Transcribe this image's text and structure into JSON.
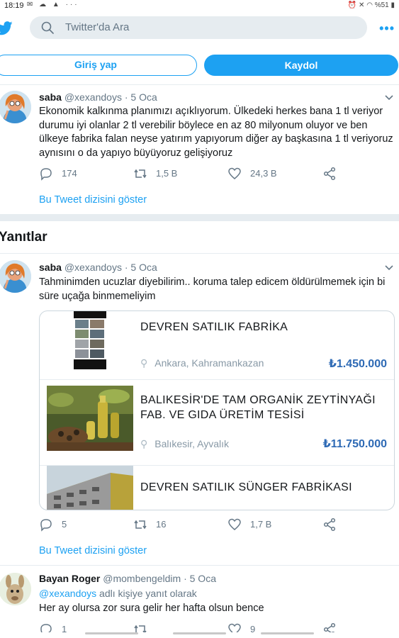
{
  "status_bar": {
    "time": "18:19",
    "left_icons": "✉ ☁ ▲ ···",
    "right_icons": "⏰ ✕ ◠ %51 ▮",
    "battery": "%51"
  },
  "header": {
    "search_placeholder": "Twitter'da Ara",
    "more_label": "•••",
    "login_label": "Giriş yap",
    "signup_label": "Kaydol"
  },
  "main_tweet": {
    "name": "saba",
    "handle": "@xexandoys",
    "dot": "·",
    "date": "5 Oca",
    "text": "Ekonomik kalkınma planımızı açıklıyorum. Ülkedeki herkes bana 1 tl veriyor durumu iyi olanlar 2 tl verebilir böylece en az 80 milyonum oluyor ve ben ülkeye fabrika falan neyse yatırım yapıyorum diğer ay başkasına 1 tl veriyoruz aynısını o da yapıyo büyüyoruz gelişiyoruz",
    "replies": "174",
    "retweets": "1,5 B",
    "likes": "24,3 B",
    "show_thread": "Bu Tweet dizisini göster"
  },
  "replies_section": {
    "title": "Yanıtlar"
  },
  "reply_tweet": {
    "name": "saba",
    "handle": "@xexandoys",
    "dot": "·",
    "date": "5 Oca",
    "text": "Tahminimden ucuzlar diyebilirim.. koruma talep edicem öldürülmemek için bi süre uçağa binmemeliyim",
    "listings": [
      {
        "title": "DEVREN SATILIK FABRİKA",
        "location": "Ankara, Kahramankazan",
        "price": "₺1.450.000"
      },
      {
        "title": "BALIKESİR'DE TAM ORGANİK ZEYTİNYAĞI FAB. VE GIDA ÜRETİM TESİSİ",
        "location": "Balıkesir, Ayvalık",
        "price": "₺11.750.000"
      },
      {
        "title": "DEVREN SATILIK SÜNGER FABRİKASI",
        "location": "",
        "price": ""
      }
    ],
    "pin_icon": "map-pin-icon",
    "replies": "5",
    "retweets": "16",
    "likes": "1,7 B",
    "show_thread": "Bu Tweet dizisini göster"
  },
  "third_tweet": {
    "name": "Bayan Roger",
    "handle": "@mombengeldim",
    "dot": "·",
    "date": "5 Oca",
    "reply_to_handle": "@xexandoys",
    "reply_to_suffix": " adlı kişiye yanıt olarak",
    "text": "Her ay olursa zor sura gelir her hafta olsun bence",
    "replies": "1",
    "likes": "9"
  },
  "colors": {
    "accent": "#1da1f2",
    "price": "#2e6ab5",
    "muted": "#657786",
    "separator": "#e6ecf0"
  }
}
